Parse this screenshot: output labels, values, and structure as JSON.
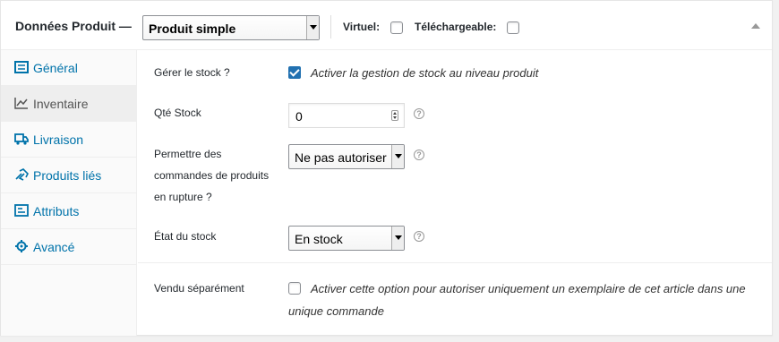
{
  "header": {
    "title": "Données Produit —",
    "product_type": "Produit simple",
    "virtual_label": "Virtuel:",
    "downloadable_label": "Téléchargeable:"
  },
  "tabs": [
    {
      "label": "Général",
      "icon": "general-icon",
      "active": false
    },
    {
      "label": "Inventaire",
      "icon": "inventory-icon",
      "active": true
    },
    {
      "label": "Livraison",
      "icon": "truck-icon",
      "active": false
    },
    {
      "label": "Produits liés",
      "icon": "link-icon",
      "active": false
    },
    {
      "label": "Attributs",
      "icon": "attributes-icon",
      "active": false
    },
    {
      "label": "Avancé",
      "icon": "gear-icon",
      "active": false
    }
  ],
  "inventory": {
    "manage_stock_label": "Gérer le stock ?",
    "manage_stock_hint": "Activer la gestion de stock au niveau produit",
    "manage_stock_checked": true,
    "qty_label": "Qté Stock",
    "qty_value": "0",
    "backorders_label_1": "Permettre des",
    "backorders_label_2": "commandes de produits",
    "backorders_label_3": "en rupture ?",
    "backorders_value": "Ne pas autoriser",
    "stock_status_label": "État du stock",
    "stock_status_value": "En stock",
    "sold_individually_label": "Vendu séparément",
    "sold_individually_hint_1": "Activer cette option pour autoriser uniquement un exemplaire de cet article dans une",
    "sold_individually_hint_2": "unique commande",
    "sold_individually_checked": false
  },
  "colors": {
    "accent": "#0073aa",
    "checkbox": "#2271b1"
  }
}
